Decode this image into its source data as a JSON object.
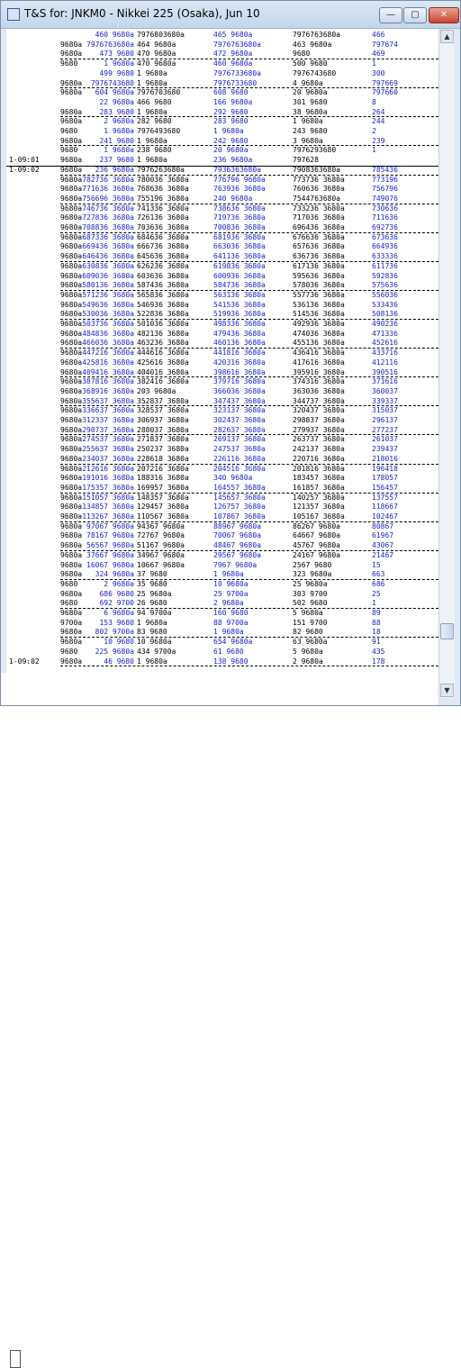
{
  "window": {
    "title": "T&S for: JNKM0 - Nikkei 225 (Osaka), Jun 10",
    "minimize_glyph": "—",
    "maximize_glyph": "▢",
    "close_glyph": "✕"
  },
  "scrollbar": {
    "up_glyph": "▲",
    "down_glyph": "▼",
    "position": 0.93
  },
  "rows": [
    {
      "t": "",
      "c": [
        "",
        "460 9680a",
        "7976803680a",
        "465 9680a",
        "7976763680a",
        "466"
      ]
    },
    {
      "t": "",
      "c": [
        "9680a",
        "7976763680a",
        "464 9680a",
        "7976763680a",
        "463 9680a",
        "797674"
      ]
    },
    {
      "t": "",
      "c": [
        "9680a",
        "473 9680",
        "470 9680a",
        "472 9680a",
        "9680",
        "469"
      ]
    },
    {
      "t": "",
      "c": [
        "9680",
        "1 9680a",
        "470 9680a",
        "460 9680a",
        "500 9680",
        "1"
      ]
    },
    {
      "t": "",
      "c": [
        "",
        "499 9680",
        "1 9680a",
        "7976733680a",
        "7976743680",
        "300"
      ]
    },
    {
      "t": "",
      "c": [
        "9680a",
        "7976743680",
        "1 9680a",
        "7976733680",
        "4 9680a",
        "797669"
      ]
    },
    {
      "t": "",
      "c": [
        "9680a",
        "604 9680a",
        "7976703680",
        "608 9680",
        "20 9680a",
        "797660"
      ]
    },
    {
      "t": "",
      "c": [
        "",
        "22 9680a",
        "466 9680",
        "166 9680a",
        "301 9680",
        "8"
      ]
    },
    {
      "t": "",
      "c": [
        "9680a",
        "283 9680",
        "1 9680a",
        "292 9680",
        "38 9680a",
        "264"
      ]
    },
    {
      "t": "",
      "c": [
        "9680a",
        "2 9680a",
        "282 9680",
        "283 9680",
        "1 9680a",
        "244"
      ]
    },
    {
      "t": "",
      "c": [
        "9680",
        "1 9680a",
        "7976493680",
        "1 9680a",
        "243 9680",
        "2"
      ]
    },
    {
      "t": "",
      "c": [
        "9680a",
        "241 9680",
        "1 9680a",
        "242 9680",
        "3 9680a",
        "239"
      ]
    },
    {
      "t": "",
      "c": [
        "9680",
        "1 9680a",
        "238 9680",
        "20 9680a",
        "7976293680",
        "1"
      ]
    },
    {
      "t": "1-09:01",
      "c": [
        "9680a",
        "237 9680",
        "1 9680a",
        "236 9680a",
        "797628",
        ""
      ]
    },
    {
      "t": "1-09:02",
      "c": [
        "9680a",
        "236 9680a",
        "7976263680a",
        "7936363680a",
        "7908363680a",
        "785436"
      ]
    },
    {
      "t": "",
      "c": [
        "9680a",
        "782736 3680a",
        "780036 3680a",
        "776796 9680a",
        "773736 3680a",
        "773196"
      ]
    },
    {
      "t": "",
      "c": [
        "9680a",
        "771636 3680a",
        "768636 3680a",
        "763936 3680a",
        "760636 3680a",
        "756796"
      ]
    },
    {
      "t": "",
      "c": [
        "9680a",
        "756696 3680a",
        "755196 3680a",
        "240 9680a",
        "7544763680a",
        "749076"
      ]
    },
    {
      "t": "",
      "c": [
        "9680a",
        "746736 3680a",
        "741336 3680a",
        "738636 3680a",
        "733236 3680a",
        "730636"
      ]
    },
    {
      "t": "",
      "c": [
        "9680a",
        "727836 3680a",
        "726136 3680a",
        "719736 3680a",
        "717036 3680a",
        "711636"
      ]
    },
    {
      "t": "",
      "c": [
        "9680a",
        "708836 3680a",
        "703636 3680a",
        "700836 3680a",
        "696436 3680a",
        "692736"
      ]
    },
    {
      "t": "",
      "c": [
        "9680a",
        "687336 3680a",
        "684636 3680a",
        "681936 3680a",
        "676636 3680a",
        "673636"
      ]
    },
    {
      "t": "",
      "c": [
        "9680a",
        "669436 3680a",
        "666736 3680a",
        "663036 3680a",
        "657636 3680a",
        "664936"
      ]
    },
    {
      "t": "",
      "c": [
        "9680a",
        "646436 3680a",
        "645636 3680a",
        "641136 3680a",
        "636736 3680a",
        "633336"
      ]
    },
    {
      "t": "",
      "c": [
        "9680a",
        "630836 3680a",
        "626236 3680a",
        "619836 3680a",
        "617136 3680a",
        "611736"
      ]
    },
    {
      "t": "",
      "c": [
        "9680a",
        "609036 3680a",
        "603636 3680a",
        "600936 3680a",
        "595636 3680a",
        "592836"
      ]
    },
    {
      "t": "",
      "c": [
        "9680a",
        "580136 3680a",
        "587436 3680a",
        "584736 3680a",
        "578036 3680a",
        "575636"
      ]
    },
    {
      "t": "",
      "c": [
        "9680a",
        "571236 3680a",
        "565836 3680a",
        "563136 3680a",
        "557736 3680a",
        "556036"
      ]
    },
    {
      "t": "",
      "c": [
        "9680a",
        "549636 3680a",
        "546936 3680a",
        "541536 3680a",
        "536136 3680a",
        "533436"
      ]
    },
    {
      "t": "",
      "c": [
        "9680a",
        "530036 3680a",
        "522836 3680a",
        "519936 3680a",
        "514536 3680a",
        "508136"
      ]
    },
    {
      "t": "",
      "c": [
        "9680a",
        "503736 3680a",
        "501036 3680a",
        "498336 3680a",
        "492936 3680a",
        "490236"
      ]
    },
    {
      "t": "",
      "c": [
        "9680a",
        "484836 3680a",
        "482136 3680a",
        "479436 3680a",
        "474036 3680a",
        "471336"
      ]
    },
    {
      "t": "",
      "c": [
        "9680a",
        "466036 3680a",
        "463236 3680a",
        "460136 3680a",
        "455136 3680a",
        "452616"
      ]
    },
    {
      "t": "",
      "c": [
        "9680a",
        "447216 3680a",
        "444616 3680a",
        "441816 3680a",
        "436416 3680a",
        "433716"
      ]
    },
    {
      "t": "",
      "c": [
        "9680a",
        "425816 3680a",
        "425616 3680a",
        "420316 3680a",
        "417616 3680a",
        "412116"
      ]
    },
    {
      "t": "",
      "c": [
        "9680a",
        "409416 3680a",
        "404016 3680a",
        "398616 3680a",
        "395916 3680a",
        "390516"
      ]
    },
    {
      "t": "",
      "c": [
        "9680a",
        "387816 3680a",
        "382416 3680a",
        "379716 3680a",
        "374316 3680a",
        "371616"
      ]
    },
    {
      "t": "",
      "c": [
        "9680a",
        "368916 3680a",
        "203 9680a",
        "366036 3680a",
        "363036 3680a",
        "360037"
      ]
    },
    {
      "t": "",
      "c": [
        "9680a",
        "355637 3680a",
        "352837 3680a",
        "347437 3680a",
        "344737 3680a",
        "339337"
      ]
    },
    {
      "t": "",
      "c": [
        "9680a",
        "336637 3680a",
        "328537 3680a",
        "323137 3680a",
        "320437 3680a",
        "315037"
      ]
    },
    {
      "t": "",
      "c": [
        "9680a",
        "312337 3680a",
        "306937 3680a",
        "302437 3680a",
        "298837 3680a",
        "296137"
      ]
    },
    {
      "t": "",
      "c": [
        "9680a",
        "290737 3680a",
        "288037 3680a",
        "282637 3680a",
        "279937 3680a",
        "277237"
      ]
    },
    {
      "t": "",
      "c": [
        "9680a",
        "274537 3680a",
        "271837 3680a",
        "269137 3680a",
        "263737 3680a",
        "261037"
      ]
    },
    {
      "t": "",
      "c": [
        "9680a",
        "255637 3680a",
        "250237 3680a",
        "247537 3680a",
        "242137 3680a",
        "239437"
      ]
    },
    {
      "t": "",
      "c": [
        "9680a",
        "234037 3680a",
        "228618 3680a",
        "226116 3680a",
        "220716 3680a",
        "218016"
      ]
    },
    {
      "t": "",
      "c": [
        "9680a",
        "212616 3680a",
        "207216 3680a",
        "204516 3680a",
        "201816 3680a",
        "196418"
      ]
    },
    {
      "t": "",
      "c": [
        "9680a",
        "191016 3680a",
        "188316 3680a",
        "340 9680a",
        "183457 3680a",
        "178057"
      ]
    },
    {
      "t": "",
      "c": [
        "9680a",
        "175357 3680a",
        "169957 3680a",
        "164557 3680a",
        "161857 3680a",
        "156457"
      ]
    },
    {
      "t": "",
      "c": [
        "9680a",
        "151057 3680a",
        "148357 3680a",
        "145657 3680a",
        "140257 3680a",
        "137557"
      ]
    },
    {
      "t": "",
      "c": [
        "9680a",
        "134857 3680a",
        "129457 3680a",
        "126757 3680a",
        "121357 3680a",
        "118667"
      ]
    },
    {
      "t": "",
      "c": [
        "9680a",
        "113267 3680a",
        "110567 3680a",
        "107867 3680a",
        "105167 3680a",
        "102467"
      ]
    },
    {
      "t": "",
      "c": [
        "9680a",
        "97067 9680a",
        "94367 9680a",
        "88967 9680a",
        "86267 9680a",
        "80867"
      ]
    },
    {
      "t": "",
      "c": [
        "9680a",
        "78167 9680a",
        "72767 9680a",
        "70067 9680a",
        "64667 9680a",
        "61967"
      ]
    },
    {
      "t": "",
      "c": [
        "9680a",
        "56567 9680a",
        "51167 9680a",
        "48467 9680a",
        "45767 9680a",
        "43067"
      ]
    },
    {
      "t": "",
      "c": [
        "9680a",
        "37667 9680a",
        "34967 9680a",
        "29567 9680a",
        "24167 9680a",
        "21467"
      ]
    },
    {
      "t": "",
      "c": [
        "9680a",
        "16067 9680a",
        "10667 9680a",
        "7967 9680a",
        "2567 9680",
        "15"
      ]
    },
    {
      "t": "",
      "c": [
        "9680a",
        "324 9680a",
        "37 9680",
        "1 9680a",
        "323 9680a",
        "663"
      ]
    },
    {
      "t": "",
      "c": [
        "9680",
        "2 9680a",
        "35 9680",
        "10 9680a",
        "25 9680a",
        "686"
      ]
    },
    {
      "t": "",
      "c": [
        "9680a",
        "686 9680",
        "25 9680a",
        "25 9700a",
        "303 9700",
        "25"
      ]
    },
    {
      "t": "",
      "c": [
        "9680",
        "692 9700",
        "26 9680",
        "2 9680a",
        "502 9680",
        "1"
      ]
    },
    {
      "t": "",
      "c": [
        "9680a",
        "6 9680a",
        "94 9700a",
        "160 9680",
        "5 9680a",
        "89"
      ]
    },
    {
      "t": "",
      "c": [
        "9700a",
        "153 9680",
        "1 9680a",
        "88 9700a",
        "151 9700",
        "88"
      ]
    },
    {
      "t": "",
      "c": [
        "9680a",
        "802 9700a",
        "83 9680",
        "1 9680a",
        "82 9680",
        "18"
      ]
    },
    {
      "t": "",
      "c": [
        "9680a",
        "10 9680",
        "10 9680a",
        "654 9680a",
        "63 9680a",
        "91"
      ]
    },
    {
      "t": "",
      "c": [
        "9680",
        "225 9680a",
        "434 9700a",
        "61 9680",
        "5 9680a",
        "435"
      ]
    },
    {
      "t": "1-09:02",
      "c": [
        "9680a",
        "46 9680",
        "1 9680a",
        "138 9680",
        "2 9680a",
        "178"
      ]
    }
  ]
}
